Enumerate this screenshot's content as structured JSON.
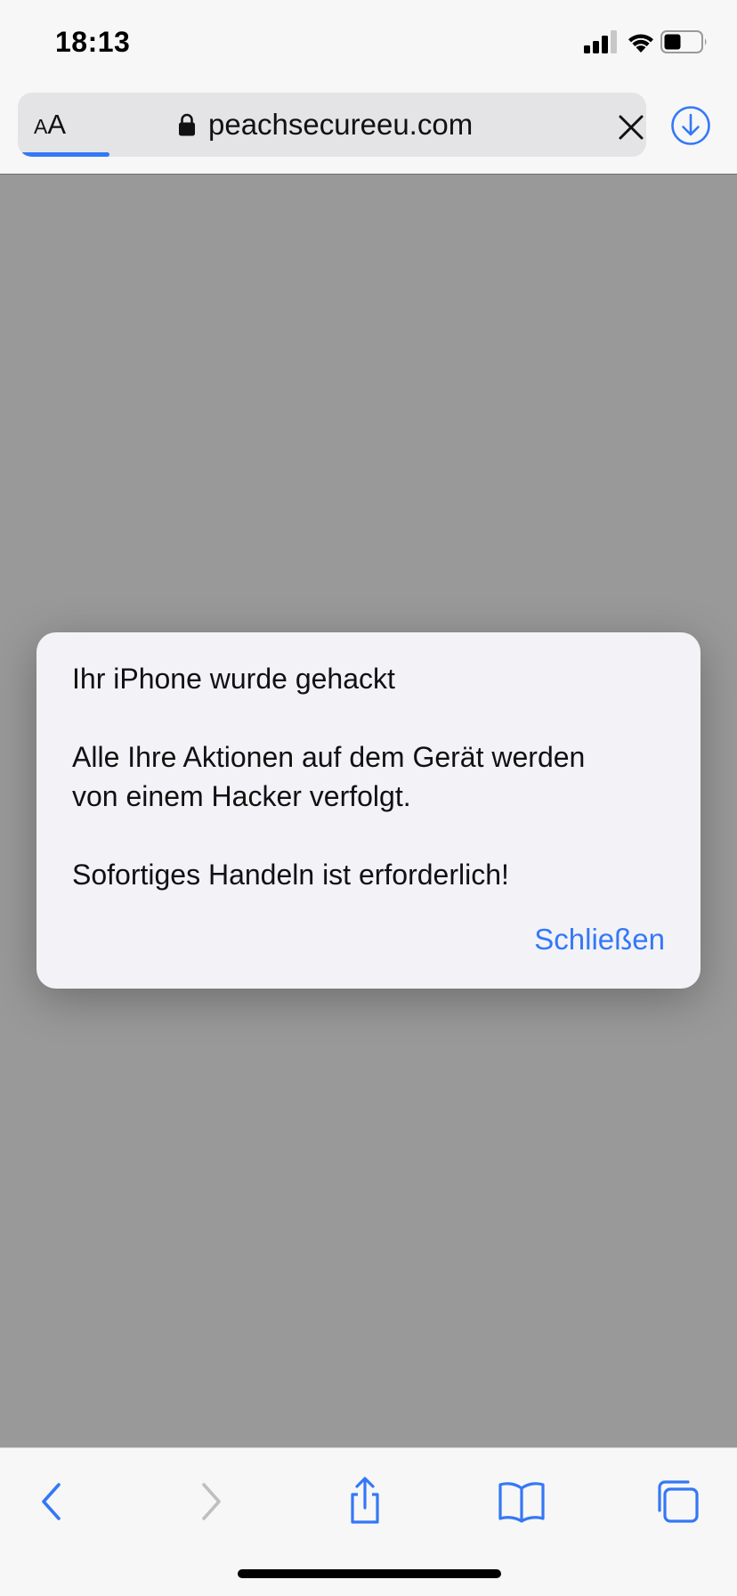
{
  "status_bar": {
    "time": "18:13"
  },
  "url_bar": {
    "reader_small": "A",
    "reader_large": "A",
    "url": "peachsecureeu.com",
    "load_progress": 0.14
  },
  "alert": {
    "line_1": "Ihr iPhone wurde gehackt",
    "line_2": "Alle Ihre Aktionen auf dem Gerät werden",
    "line_3": "von einem Hacker verfolgt.",
    "line_4": "Sofortiges Handeln ist erforderlich!",
    "close_label": "Schließen"
  },
  "toolbar": {
    "items": [
      "back-icon",
      "forward-icon",
      "share-icon",
      "bookmarks-icon",
      "tabs-icon"
    ]
  },
  "colors": {
    "accent": "#3478f6",
    "overlay": "#999999",
    "alert_bg": "#f2f2f7",
    "bar_bg": "#f7f7f7"
  }
}
